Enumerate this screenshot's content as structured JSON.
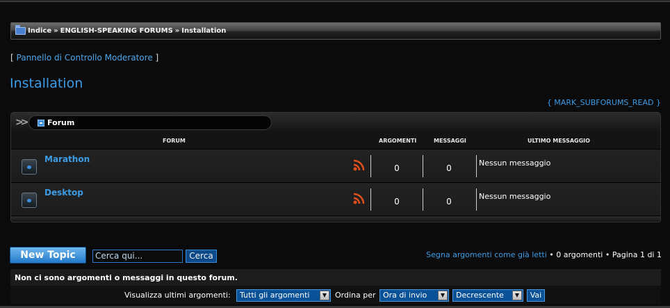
{
  "breadcrumb": {
    "items": [
      "Indice",
      "ENGLISH-SPEAKING FORUMS",
      "Installation"
    ],
    "separator": "»"
  },
  "mod_panel": {
    "open": "[",
    "label": "Pannello di Controllo Moderatore",
    "close": "]"
  },
  "page_title": "Installation",
  "mark_subforums": "{ MARK_SUBFORUMS_READ }",
  "category": {
    "title": "Forum"
  },
  "columns": {
    "forum": "FORUM",
    "topics": "ARGOMENTI",
    "posts": "MESSAGGI",
    "last_post": "ULTIMO MESSAGGIO"
  },
  "forums": [
    {
      "name": "Marathon",
      "topics": "0",
      "posts": "0",
      "last_post": "Nessun messaggio"
    },
    {
      "name": "Desktop",
      "topics": "0",
      "posts": "0",
      "last_post": "Nessun messaggio"
    }
  ],
  "actions": {
    "new_topic": "New Topic",
    "search_placeholder": "Cerca qui...",
    "search_button": "Cerca"
  },
  "page_info": {
    "mark_read": "Segna argomenti come già letti",
    "topics_count": " • 0 argomenti • Pagina 1 di 1"
  },
  "no_topics_message": "Non ci sono argomenti o messaggi in questo forum.",
  "sort": {
    "display_label": "Visualizza ultimi argomenti:",
    "display_value": "Tutti gli argomenti",
    "order_label": "Ordina per",
    "order_value": "Ora di invio",
    "direction_value": "Decrescente",
    "go": "Vai"
  },
  "colors": {
    "link": "#3c9ce6",
    "background": "#0b0b0b",
    "rss": "#e0501c",
    "button": "#2279c8"
  },
  "icons": [
    "folder-icon",
    "chevron-right-icon",
    "minus-icon",
    "forum-read-icon",
    "rss-icon",
    "dropdown-arrow-icon"
  ]
}
